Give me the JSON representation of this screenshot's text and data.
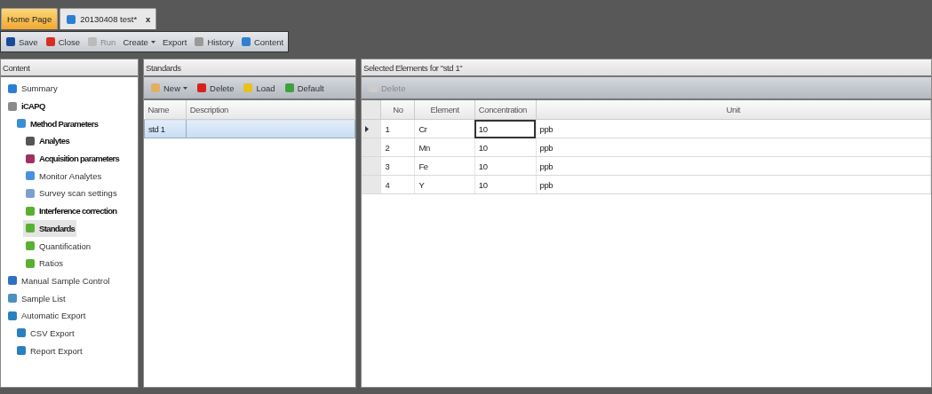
{
  "tabs": [
    {
      "label": "Home Page",
      "selected": false
    },
    {
      "label": "20130408 test*",
      "selected": true,
      "close": "x"
    }
  ],
  "toolbar": [
    {
      "label": "Save",
      "disabled": false,
      "dropdown": false
    },
    {
      "label": "Close",
      "disabled": false,
      "dropdown": false
    },
    {
      "label": "Run",
      "disabled": true,
      "dropdown": false
    },
    {
      "label": "Create",
      "disabled": false,
      "dropdown": true
    },
    {
      "label": "Export",
      "disabled": false,
      "dropdown": false
    },
    {
      "label": "History",
      "disabled": false,
      "dropdown": false
    },
    {
      "label": "Content",
      "disabled": false,
      "dropdown": false
    }
  ],
  "sidebar": {
    "title": "Content",
    "items": [
      {
        "label": "Summary",
        "bold": false,
        "selected": false
      },
      {
        "label": "iCAPQ",
        "bold": true,
        "selected": false,
        "children": [
          {
            "label": "Method Parameters",
            "bold": true,
            "selected": false,
            "children": [
              {
                "label": "Analytes",
                "bold": true,
                "selected": false
              },
              {
                "label": "Acquisition parameters",
                "bold": true,
                "selected": false
              },
              {
                "label": "Monitor Analytes",
                "bold": false,
                "selected": false
              },
              {
                "label": "Survey scan settings",
                "bold": false,
                "selected": false
              },
              {
                "label": "Interference correction",
                "bold": true,
                "selected": false
              },
              {
                "label": "Standards",
                "bold": true,
                "selected": true
              },
              {
                "label": "Quantification",
                "bold": false,
                "selected": false
              },
              {
                "label": "Ratios",
                "bold": false,
                "selected": false
              }
            ]
          }
        ]
      },
      {
        "label": "Manual Sample Control",
        "bold": false,
        "selected": false
      },
      {
        "label": "Sample List",
        "bold": false,
        "selected": false
      },
      {
        "label": "Automatic Export",
        "bold": false,
        "selected": false,
        "children": [
          {
            "label": "CSV Export",
            "bold": false,
            "selected": false
          },
          {
            "label": "Report Export",
            "bold": false,
            "selected": false
          }
        ]
      }
    ]
  },
  "standards": {
    "title": "Standards",
    "toolbar": [
      {
        "label": "New",
        "dropdown": true
      },
      {
        "label": "Delete",
        "dropdown": false
      },
      {
        "label": "Load",
        "dropdown": false
      },
      {
        "label": "Default",
        "dropdown": false
      }
    ],
    "columns": [
      "Name",
      "Description"
    ],
    "rows": [
      {
        "name": "std 1",
        "selected": true
      }
    ]
  },
  "elements": {
    "title": "Selected Elements for \"std 1\"",
    "toolbar": [
      {
        "label": "Delete",
        "disabled": true
      }
    ],
    "columns": [
      "No",
      "Element",
      "Concentration",
      "Unit"
    ],
    "rows": [
      {
        "no": "1",
        "element": "Cr",
        "concentration": "10",
        "unit": "ppb",
        "current": true
      },
      {
        "no": "2",
        "element": "Mn",
        "concentration": "10",
        "unit": "ppb",
        "current": false
      },
      {
        "no": "3",
        "element": "Fe",
        "concentration": "10",
        "unit": "ppb",
        "current": false
      },
      {
        "no": "4",
        "element": "Y",
        "concentration": "10",
        "unit": "ppb",
        "current": false
      }
    ]
  }
}
